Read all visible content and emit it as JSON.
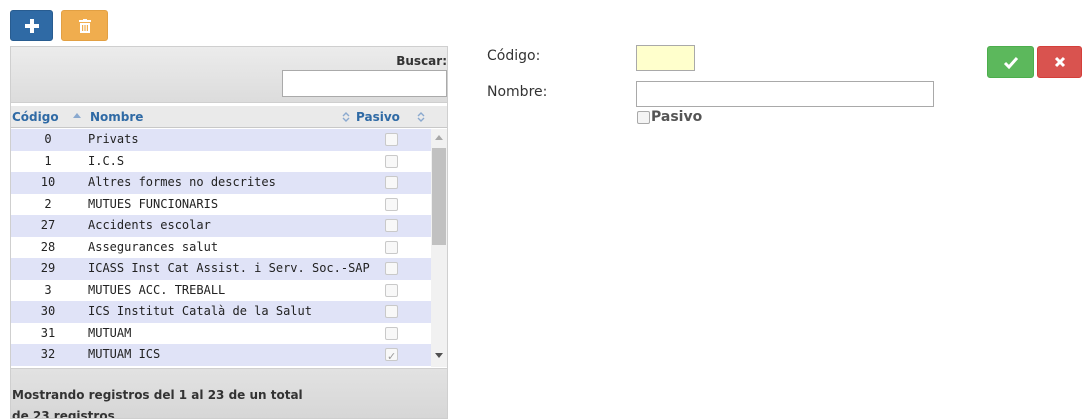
{
  "toolbar": {
    "add_icon": "plus-icon",
    "delete_icon": "trash-icon",
    "colors": {
      "add": "#2f6aa5",
      "delete": "#f0ad4e",
      "ok": "#5cb85c",
      "cancel": "#d9534f"
    }
  },
  "search": {
    "label": "Buscar:",
    "value": ""
  },
  "grid": {
    "columns": [
      "Código",
      "Nombre",
      "Pasivo"
    ],
    "sort": {
      "column": "Código",
      "direction": "asc"
    },
    "rows": [
      {
        "codigo": "0",
        "nombre": "Privats",
        "pasivo": false
      },
      {
        "codigo": "1",
        "nombre": "I.C.S",
        "pasivo": false
      },
      {
        "codigo": "10",
        "nombre": "Altres formes no descrites",
        "pasivo": false
      },
      {
        "codigo": "2",
        "nombre": "MUTUES FUNCIONARIS",
        "pasivo": false
      },
      {
        "codigo": "27",
        "nombre": "Accidents escolar",
        "pasivo": false
      },
      {
        "codigo": "28",
        "nombre": "Assegurances salut",
        "pasivo": false
      },
      {
        "codigo": "29",
        "nombre": "ICASS Inst Cat Assist. i Serv. Soc.-SAP",
        "pasivo": false
      },
      {
        "codigo": "3",
        "nombre": "MUTUES ACC. TREBALL",
        "pasivo": false
      },
      {
        "codigo": "30",
        "nombre": "ICS Institut Català de la Salut",
        "pasivo": false
      },
      {
        "codigo": "31",
        "nombre": "MUTUAM",
        "pasivo": false
      },
      {
        "codigo": "32",
        "nombre": "MUTUAM ICS",
        "pasivo": true
      }
    ],
    "footer": "Mostrando registros del 1 al 23 de un total de 23 registros"
  },
  "form": {
    "codigo_label": "Código:",
    "codigo_value": "",
    "nombre_label": "Nombre:",
    "nombre_value": "",
    "pasivo_label": "Pasivo",
    "pasivo_checked": false
  },
  "actions": {
    "ok_icon": "check-icon",
    "cancel_icon": "close-icon"
  }
}
